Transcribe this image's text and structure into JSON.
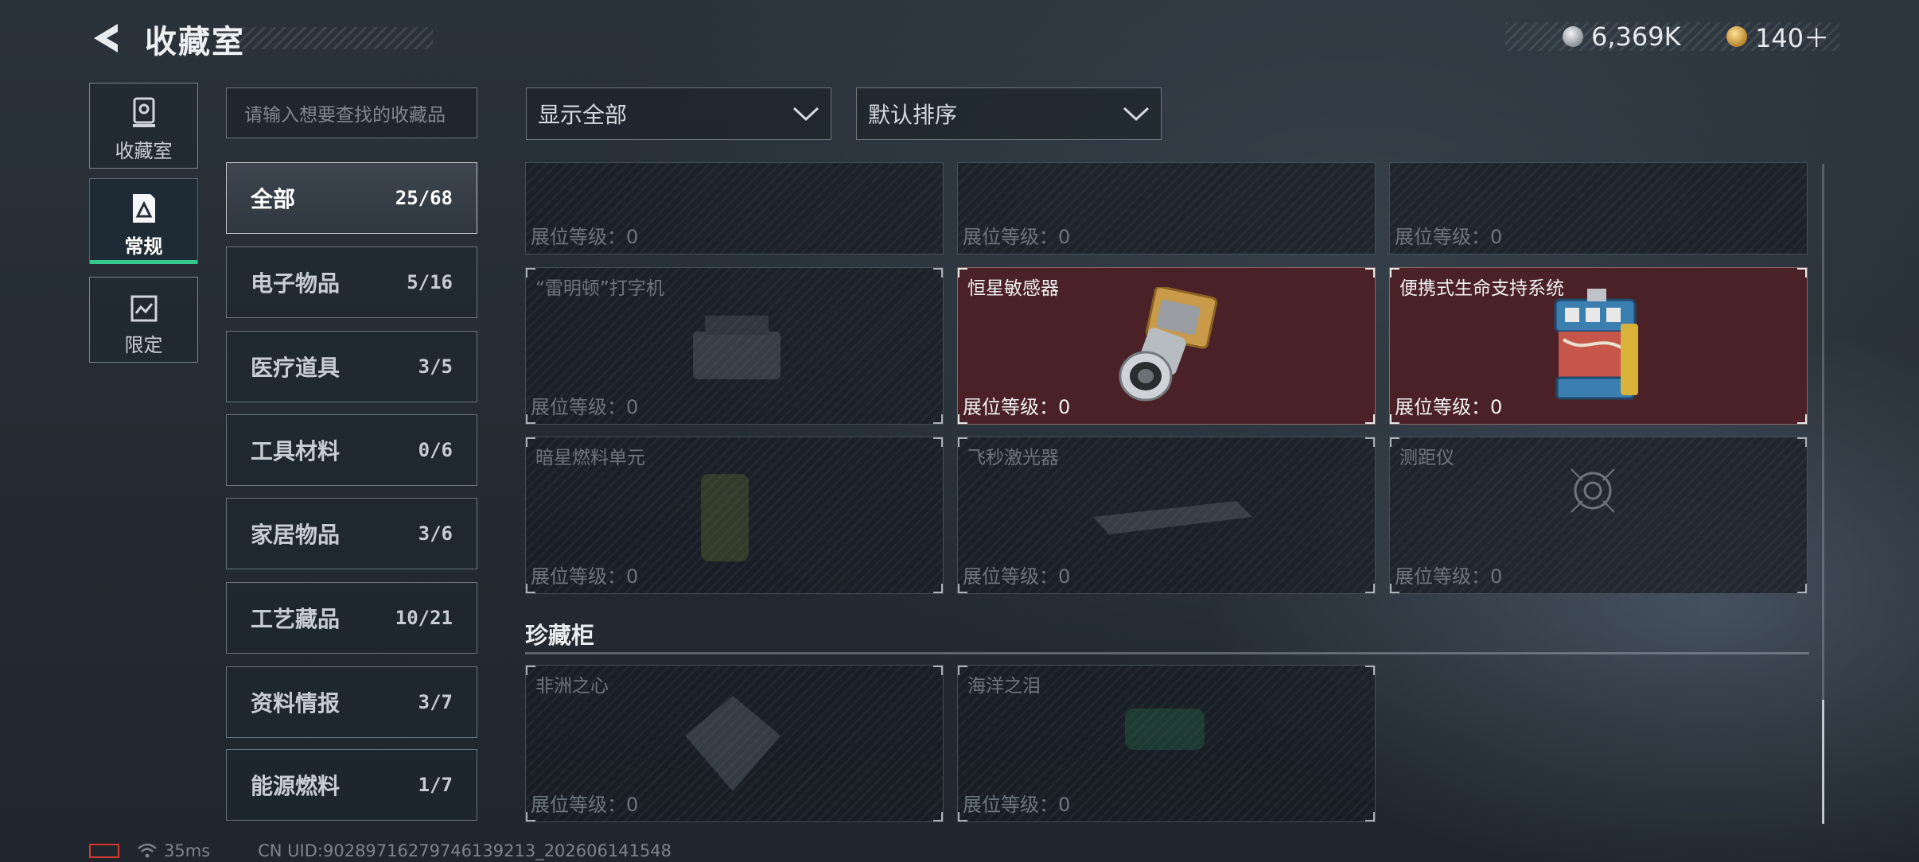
{
  "header": {
    "title": "收藏室",
    "currency": [
      {
        "icon": "silver-coin-icon",
        "value": "6,369K"
      },
      {
        "icon": "gold-coin-icon",
        "value": "140＋"
      }
    ]
  },
  "side_nav": [
    {
      "icon": "collection-room-icon",
      "label": "收藏室"
    },
    {
      "icon": "regular-card-icon",
      "label": "常规"
    },
    {
      "icon": "limited-card-icon",
      "label": "限定"
    }
  ],
  "search": {
    "placeholder": "请输入想要查找的收藏品"
  },
  "categories": [
    {
      "name": "全部",
      "count": "25/68"
    },
    {
      "name": "电子物品",
      "count": "5/16"
    },
    {
      "name": "医疗道具",
      "count": "3/5"
    },
    {
      "name": "工具材料",
      "count": "0/6"
    },
    {
      "name": "家居物品",
      "count": "3/6"
    },
    {
      "name": "工艺藏品",
      "count": "10/21"
    },
    {
      "name": "资料情报",
      "count": "3/7"
    },
    {
      "name": "能源燃料",
      "count": "1/7"
    }
  ],
  "filters": {
    "display": "显示全部",
    "sort": "默认排序"
  },
  "level_label": "展位等级：",
  "items_top": [
    {
      "name": "",
      "level": "0",
      "owned": false
    },
    {
      "name": "",
      "level": "0",
      "owned": false
    },
    {
      "name": "",
      "level": "0",
      "owned": false
    }
  ],
  "items_mid": [
    {
      "name": "“雷明顿”打字机",
      "level": "0",
      "owned": false
    },
    {
      "name": "恒星敏感器",
      "level": "0",
      "owned": true
    },
    {
      "name": "便携式生命支持系统",
      "level": "0",
      "owned": true
    }
  ],
  "items_bottom": [
    {
      "name": "暗星燃料单元",
      "level": "0",
      "owned": false
    },
    {
      "name": "飞秒激光器",
      "level": "0",
      "owned": false
    },
    {
      "name": "测距仪",
      "level": "0",
      "owned": false
    }
  ],
  "showcase": {
    "title": "珍藏柜",
    "items": [
      {
        "name": "非洲之心",
        "level": "0",
        "owned": false
      },
      {
        "name": "海洋之泪",
        "level": "0",
        "owned": false
      }
    ]
  },
  "footer": {
    "ping": "35ms",
    "uid": "CN UID:90289716279746139213_202606141548"
  },
  "colors": {
    "accent_green": "#35c78a",
    "owned_card": "#4a2126",
    "battery_red": "#d8392f"
  }
}
